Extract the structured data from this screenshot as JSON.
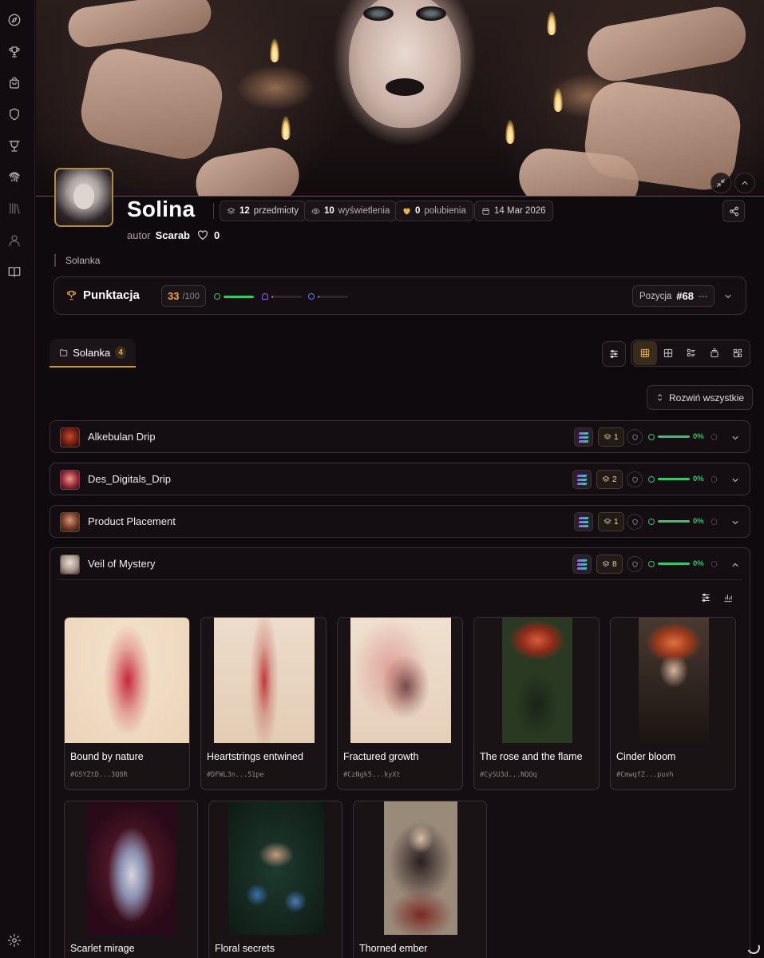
{
  "sidebar": {
    "items": [
      {
        "icon": "compass-icon"
      },
      {
        "icon": "trophy-icon"
      },
      {
        "icon": "shopping-bag-icon"
      },
      {
        "icon": "shield-icon"
      },
      {
        "icon": "cup-icon"
      },
      {
        "icon": "fingerprint-icon"
      },
      {
        "icon": "library-icon"
      },
      {
        "icon": "user-icon"
      },
      {
        "icon": "book-open-icon"
      }
    ],
    "settings_icon": "gear-icon"
  },
  "profile": {
    "title": "Solina",
    "author_label": "autor",
    "author_name": "Scarab",
    "likes": "0",
    "description": "Solanka",
    "stats": {
      "items_count": "12",
      "items_label": "przedmioty",
      "views_count": "10",
      "views_label": "wyświetlenia",
      "likes_count": "0",
      "likes_label": "polubienia",
      "date": "14 Mar 2026"
    }
  },
  "score": {
    "title": "Punktacja",
    "value": "33",
    "max": "/100",
    "bars": [
      {
        "name": "completion",
        "fill": 1.0,
        "color": "#36c66a"
      },
      {
        "name": "rarity",
        "fill": 0.05,
        "color": "#9b5cf6"
      },
      {
        "name": "holders",
        "fill": 0.05,
        "color": "#5b7cf6"
      }
    ],
    "position_label": "Pozycja",
    "position_value": "#68",
    "position_trend": "---"
  },
  "folder": {
    "label": "Solanka",
    "count": "4"
  },
  "toolbar": {
    "expand_all_label": "Rozwiń wszystkie"
  },
  "collections": [
    {
      "name": "Alkebulan Drip",
      "count": "1",
      "progress": "0%",
      "expanded": false
    },
    {
      "name": "Des_Digitals_Drip",
      "count": "2",
      "progress": "0%",
      "expanded": false
    },
    {
      "name": "Product Placement",
      "count": "1",
      "progress": "0%",
      "expanded": false
    },
    {
      "name": "Veil of Mystery",
      "count": "8",
      "progress": "0%",
      "expanded": true
    }
  ],
  "items": [
    {
      "title": "Bound by nature",
      "id": "#GSYZtD...3Q8R"
    },
    {
      "title": "Heartstrings entwined",
      "id": "#DFWL3n...51pe"
    },
    {
      "title": "Fractured growth",
      "id": "#CzNgk5...kyXt"
    },
    {
      "title": "The rose and the flame",
      "id": "#CySU3d...NQQq"
    },
    {
      "title": "Cinder bloom",
      "id": "#CmwqfZ...puvh"
    },
    {
      "title": "Scarlet mirage",
      "id": ""
    },
    {
      "title": "Floral secrets",
      "id": ""
    },
    {
      "title": "Thorned ember",
      "id": ""
    }
  ],
  "colors": {
    "accent": "#e5b54a",
    "success": "#36c66a",
    "background": "#0f0a0e"
  }
}
